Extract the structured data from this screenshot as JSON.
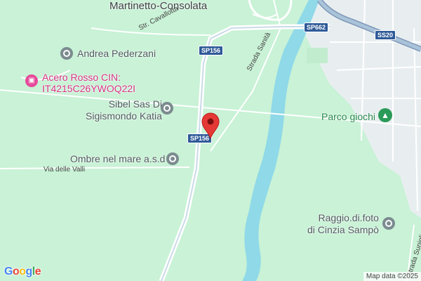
{
  "map": {
    "area_title": "Martinetto-Consolata",
    "roads": {
      "route_sp662": "SP662",
      "route_ss20": "SS20",
      "route_sp156_north": "SP156",
      "route_sp156_south": "SP156",
      "str_cavallotta": "Str. Cavallotta",
      "strada_sanita": "Strada Sanità",
      "via_delle_valli": "Via delle Valli",
      "strada_suniglia": "Strada Suniglia"
    },
    "places": [
      {
        "name": "Andrea Pederzani",
        "icon": "place-pin-icon"
      },
      {
        "name_line1": "Acero Rosso CIN:",
        "name_line2": "IT4215C26YWOQ22I",
        "icon": "hotel-bed-icon"
      },
      {
        "name_line1": "Sibel Sas Di",
        "name_line2": "Sigismondo Katia",
        "icon": "place-pin-icon"
      },
      {
        "name": "Parco giochi",
        "icon": "tree-park-icon"
      },
      {
        "name": "Ombre nel mare a.s.d",
        "icon": "place-pin-icon"
      },
      {
        "name_line1": "Raggio.di.foto",
        "name_line2": "di Cinzia Sampò",
        "icon": "place-pin-icon"
      }
    ],
    "marker": {
      "icon": "red-location-marker-icon"
    },
    "logo": "Google",
    "attribution": "Map data ©2025",
    "colors": {
      "land": "#c9f2d6",
      "urban": "#e8eef0",
      "river": "#8fd9e8",
      "road": "#ffffff",
      "highway": "#a9c3d9",
      "marker": "#e53935"
    }
  }
}
